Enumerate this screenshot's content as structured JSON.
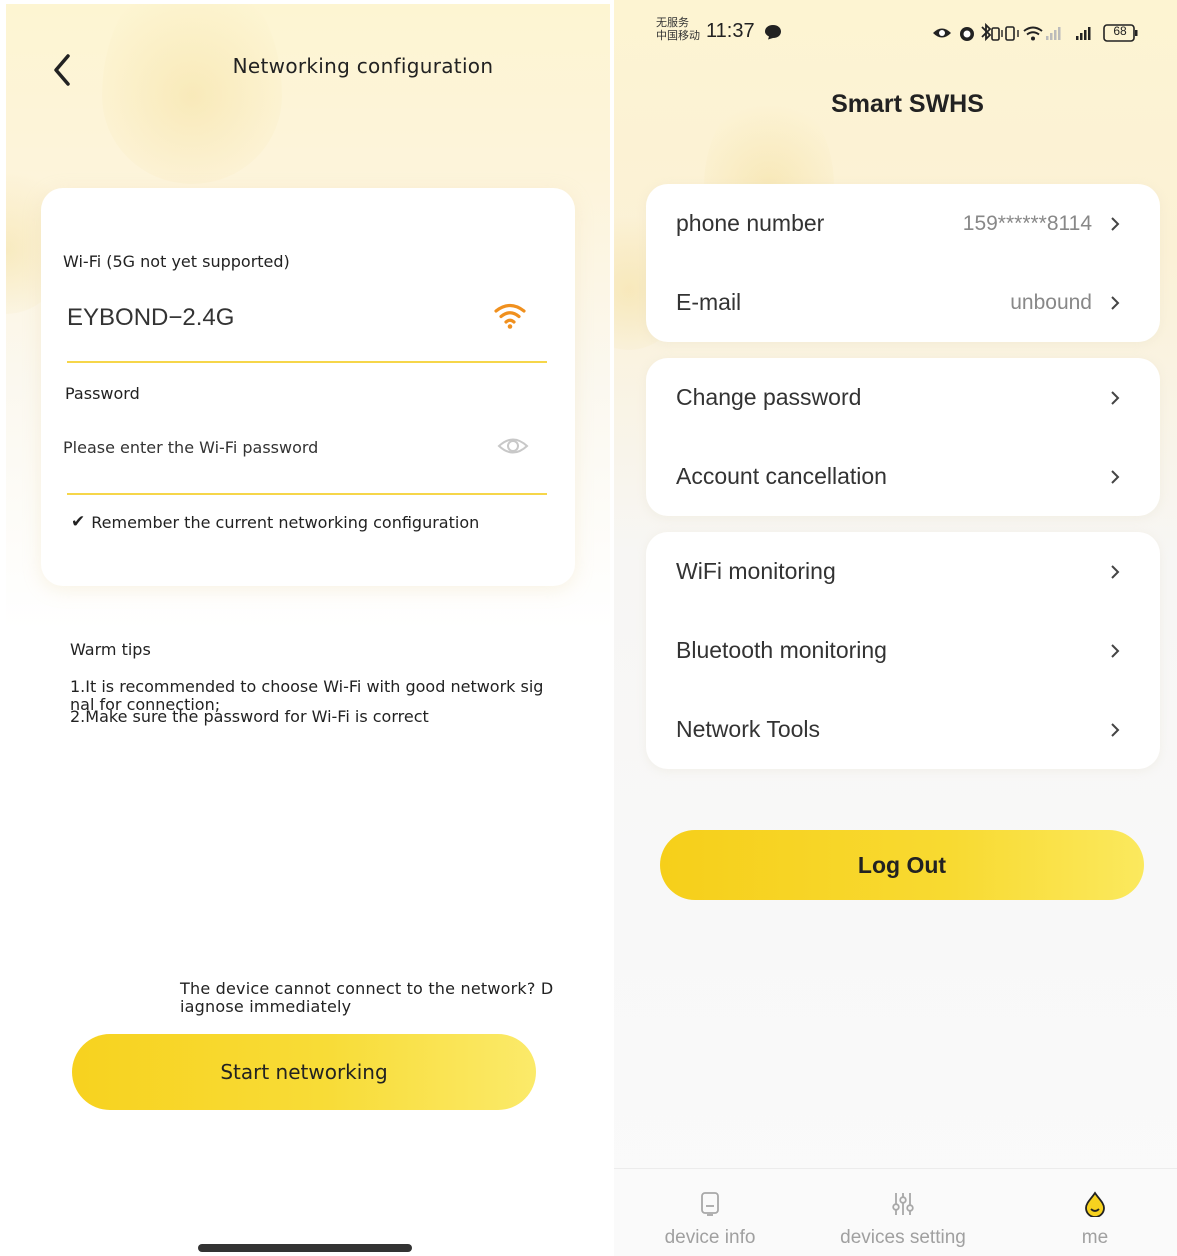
{
  "left_screen": {
    "header": {
      "title": "Networking configuration",
      "back_icon": "chevron-left-icon"
    },
    "wifi": {
      "label": "Wi-Fi (5G not yet supported)",
      "ssid": "EYBOND−2.4G",
      "signal_icon": "wifi-signal-icon",
      "signal_color": "#f0901e"
    },
    "password": {
      "label": "Password",
      "placeholder": "Please enter the Wi-Fi password",
      "toggle_icon": "eye-icon"
    },
    "remember": {
      "check": "✔",
      "label": "Remember the current networking configuration"
    },
    "tips": {
      "title": "Warm tips",
      "tip1": "1.It is recommended to choose Wi-Fi with good network sig nal for connection;",
      "tip2": "2.Make sure the password for Wi-Fi is correct"
    },
    "diagnose_link": "The device cannot connect to the network? D iagnose immediately",
    "start_button": "Start networking"
  },
  "right_screen": {
    "status_bar": {
      "carrier_line1": "无服务",
      "carrier_line2": "中国移动",
      "time": "11:37",
      "battery": "68"
    },
    "title": "Smart SWHS",
    "groups": [
      {
        "rows": [
          {
            "label": "phone number",
            "value": "159******8114"
          },
          {
            "label": "E-mail",
            "value": "unbound"
          }
        ]
      },
      {
        "rows": [
          {
            "label": "Change password"
          },
          {
            "label": "Account cancellation"
          }
        ]
      },
      {
        "rows": [
          {
            "label": "WiFi monitoring"
          },
          {
            "label": "Bluetooth monitoring"
          },
          {
            "label": "Network Tools"
          }
        ]
      }
    ],
    "logout_button": "Log Out",
    "tabs": [
      {
        "label": "device info",
        "icon": "device-icon"
      },
      {
        "label": "devices setting",
        "icon": "sliders-icon"
      },
      {
        "label": "me",
        "icon": "drop-face-icon",
        "active": true
      }
    ],
    "accent_color": "#f7d21f"
  }
}
